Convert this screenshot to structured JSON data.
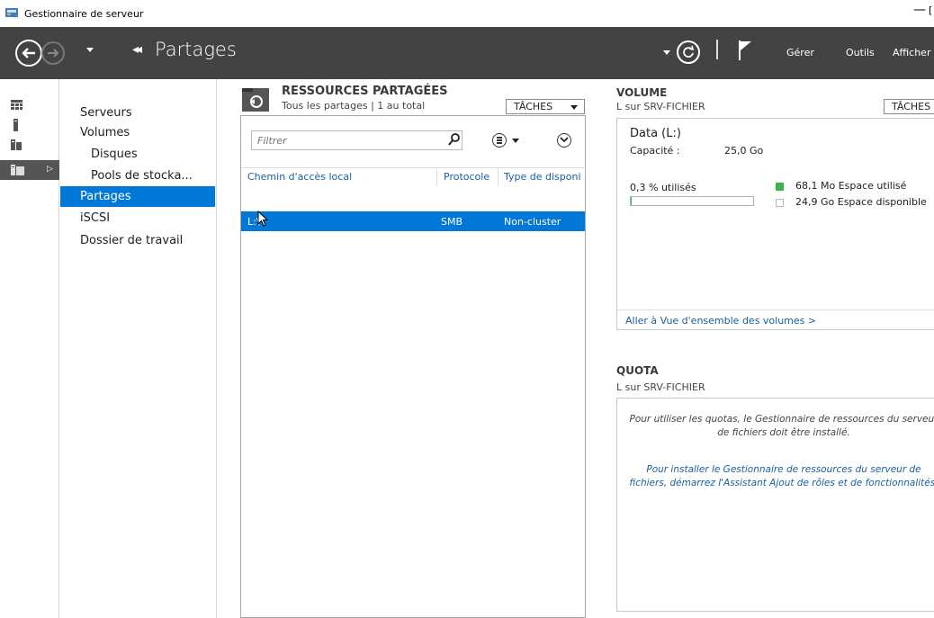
{
  "window": {
    "title": "Gestionnaire de serveur",
    "minimize_glyph": "—",
    "maximize_glyph": "[",
    "app_icon": "server-manager-icon"
  },
  "header": {
    "breadcrumb_arrows": "◂◂",
    "breadcrumb": "Partages",
    "menus": [
      "Gérer",
      "Outils",
      "Afficher"
    ],
    "icons": [
      "back-icon",
      "forward-icon",
      "refresh-icon",
      "flag-icon"
    ]
  },
  "nav": {
    "items": [
      {
        "label": "Serveurs"
      },
      {
        "label": "Volumes"
      },
      {
        "label": "Disques"
      },
      {
        "label": "Pools de stocka..."
      },
      {
        "label": "Partages"
      },
      {
        "label": "iSCSI"
      },
      {
        "label": "Dossier de travail"
      }
    ],
    "selected": "Partages"
  },
  "rail": {
    "icons": [
      "dashboard-icon",
      "local-server-icon",
      "all-servers-icon",
      "file-storage-icon"
    ],
    "active_caret": "▷"
  },
  "shares": {
    "title": "RESSOURCES PARTAGÉES",
    "subtitle": "Tous les partages | 1 au total",
    "tasks_label": "TÂCHES",
    "filter_placeholder": "Filtrer",
    "columns": [
      "Chemin d'accès local",
      "Protocole",
      "Type de disponi"
    ],
    "rows": [
      {
        "path": "L:\\",
        "protocol": "SMB",
        "availability": "Non-cluster"
      }
    ]
  },
  "volume": {
    "title": "VOLUME",
    "subtitle": "L sur SRV-FICHIER",
    "tasks_label": "TÂCHES",
    "name": "Data (L:)",
    "capacity_label": "Capacité :",
    "capacity_value": "25,0 Go",
    "usage_label": "0,3 % utilisés",
    "usage_fraction": 0.003,
    "used_text": "68,1 Mo Espace utilisé",
    "free_text": "24,9 Go Espace disponible",
    "link": "Aller à Vue d'ensemble des volumes >",
    "colors": {
      "used": "#3bb44a",
      "free": "#ffffff"
    }
  },
  "quota": {
    "title": "QUOTA",
    "subtitle": "L sur SRV-FICHIER",
    "message": "Pour utiliser les quotas, le Gestionnaire de ressources du serveur de fichiers doit être installé.",
    "link": "Pour installer le Gestionnaire de ressources du serveur de fichiers, démarrez l'Assistant Ajout de rôles et de fonctionnalités."
  },
  "colors": {
    "header_bg": "#434343",
    "accent": "#0078d7",
    "link": "#1a5fa0",
    "rail_active": "#555555"
  }
}
